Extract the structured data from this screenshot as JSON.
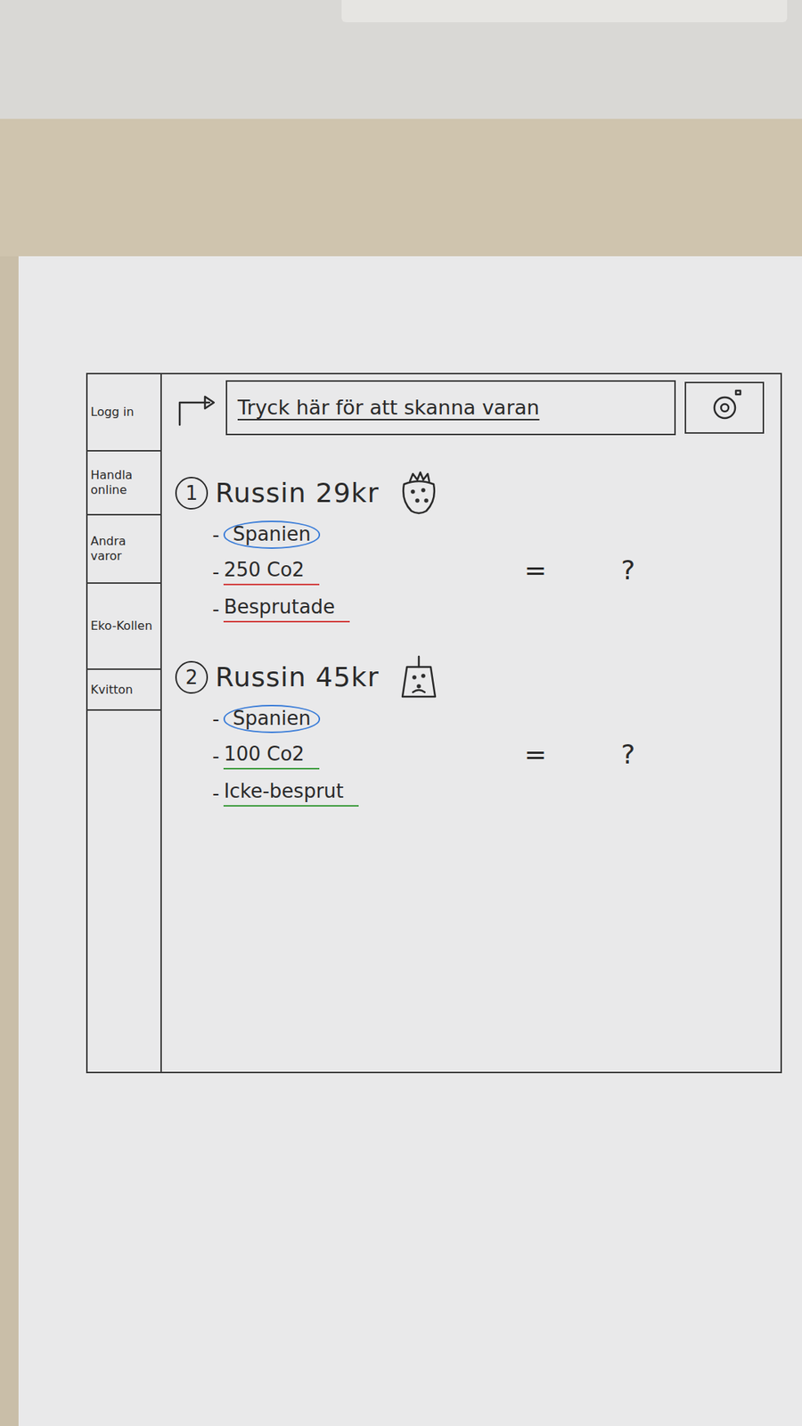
{
  "sidebar": {
    "items": [
      {
        "label": "Logg in"
      },
      {
        "label": "Handla online"
      },
      {
        "label": "Andra varor"
      },
      {
        "label": "Eko-Kollen"
      },
      {
        "label": "Kvitton"
      }
    ]
  },
  "scan_bar": {
    "label": "Tryck här för att skanna varan"
  },
  "products": [
    {
      "number": "1",
      "title": "Russin 29kr",
      "equals": "=",
      "result": "?",
      "attributes": [
        {
          "bullet": "-",
          "text": "Spanien",
          "kind": "circle",
          "color": "#3b7dd8"
        },
        {
          "bullet": "-",
          "text": "250 Co2",
          "kind": "underline",
          "color": "#d23a3a"
        },
        {
          "bullet": "-",
          "text": "Besprutade",
          "kind": "underline",
          "color": "#d23a3a"
        }
      ]
    },
    {
      "number": "2",
      "title": "Russin 45kr",
      "equals": "=",
      "result": "?",
      "attributes": [
        {
          "bullet": "-",
          "text": "Spanien",
          "kind": "circle",
          "color": "#3b7dd8"
        },
        {
          "bullet": "-",
          "text": "100 Co2",
          "kind": "underline",
          "color": "#3a9a3a"
        },
        {
          "bullet": "-",
          "text": "Icke-besprut",
          "kind": "underline",
          "color": "#3a9a3a"
        }
      ]
    }
  ]
}
